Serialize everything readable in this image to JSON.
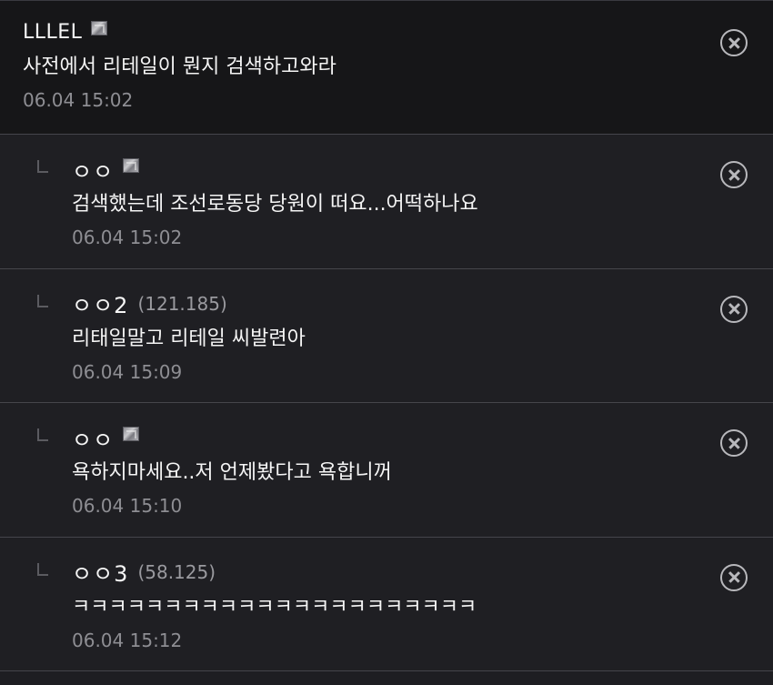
{
  "comments": [
    {
      "nick": "LLLEL",
      "ip": "",
      "fixed": true,
      "text": "사전에서 리테일이 뭔지 검색하고와라",
      "time": "06.04 15:02"
    },
    {
      "nick": "ㅇㅇ",
      "ip": "",
      "fixed": true,
      "text": "검색했는데 조선로동당 당원이 떠요...어떡하나요",
      "time": "06.04 15:02"
    },
    {
      "nick": "ㅇㅇ2",
      "ip": "(121.185)",
      "fixed": false,
      "text": "리태일말고 리테일 씨발련아",
      "time": "06.04 15:09"
    },
    {
      "nick": "ㅇㅇ",
      "ip": "",
      "fixed": true,
      "text": "욕하지마세요..저 언제봤다고 욕합니꺼",
      "time": "06.04 15:10"
    },
    {
      "nick": "ㅇㅇ3",
      "ip": "(58.125)",
      "fixed": false,
      "text": "ㅋㅋㅋㅋㅋㅋㅋㅋㅋㅋㅋㅋㅋㅋㅋㅋㅋㅋㅋㅋㅋㅋ",
      "time": "06.04 15:12"
    }
  ],
  "icons": {
    "delete": "close-circle-icon",
    "reply": "reply-arrow-icon",
    "fixed_nick": "fixed-nickname-icon"
  },
  "colors": {
    "top_bg": "#161618",
    "reply_bg": "#1f1f23",
    "divider": "#45454b",
    "text": "#f5f5f5",
    "meta": "#8e8e93"
  }
}
